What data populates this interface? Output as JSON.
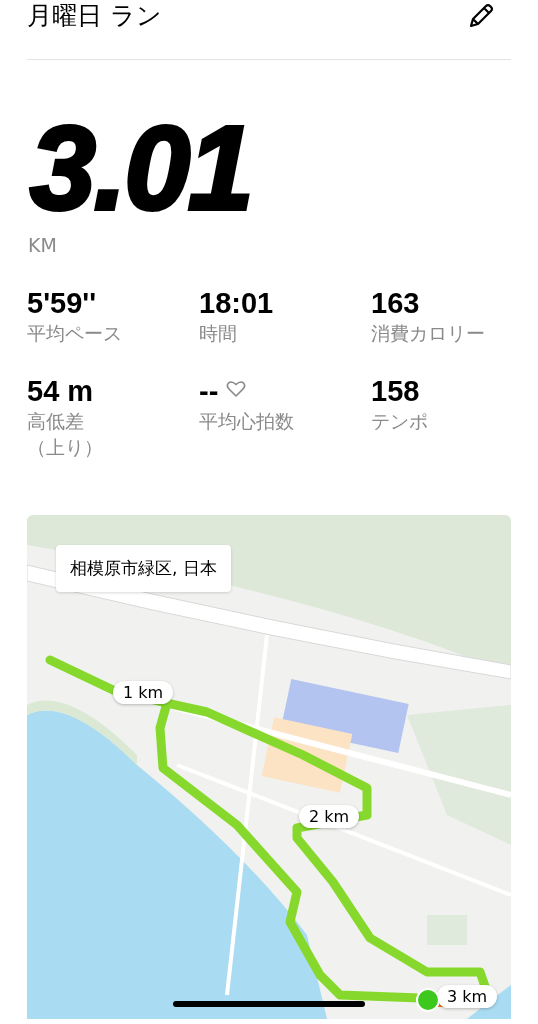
{
  "header": {
    "title": "月曜日 ラン"
  },
  "distance": {
    "value": "3.01",
    "unit": "KM"
  },
  "stats": [
    {
      "kind": "metric",
      "value": "5'59''",
      "label": "平均ペース"
    },
    {
      "kind": "metric",
      "value": "18:01",
      "label": "時間"
    },
    {
      "kind": "metric",
      "value": "163",
      "label": "消費カロリー"
    },
    {
      "kind": "metric",
      "value": "54 m",
      "label": "高低差",
      "label_2": "（上り）"
    },
    {
      "kind": "heart_rate",
      "value": "--",
      "label": "平均心拍数"
    },
    {
      "kind": "metric",
      "value": "158",
      "label": "テンポ"
    }
  ],
  "map": {
    "location": "相模原市緑区, 日本",
    "markers": [
      "1 km",
      "2 km",
      "3 km"
    ]
  }
}
